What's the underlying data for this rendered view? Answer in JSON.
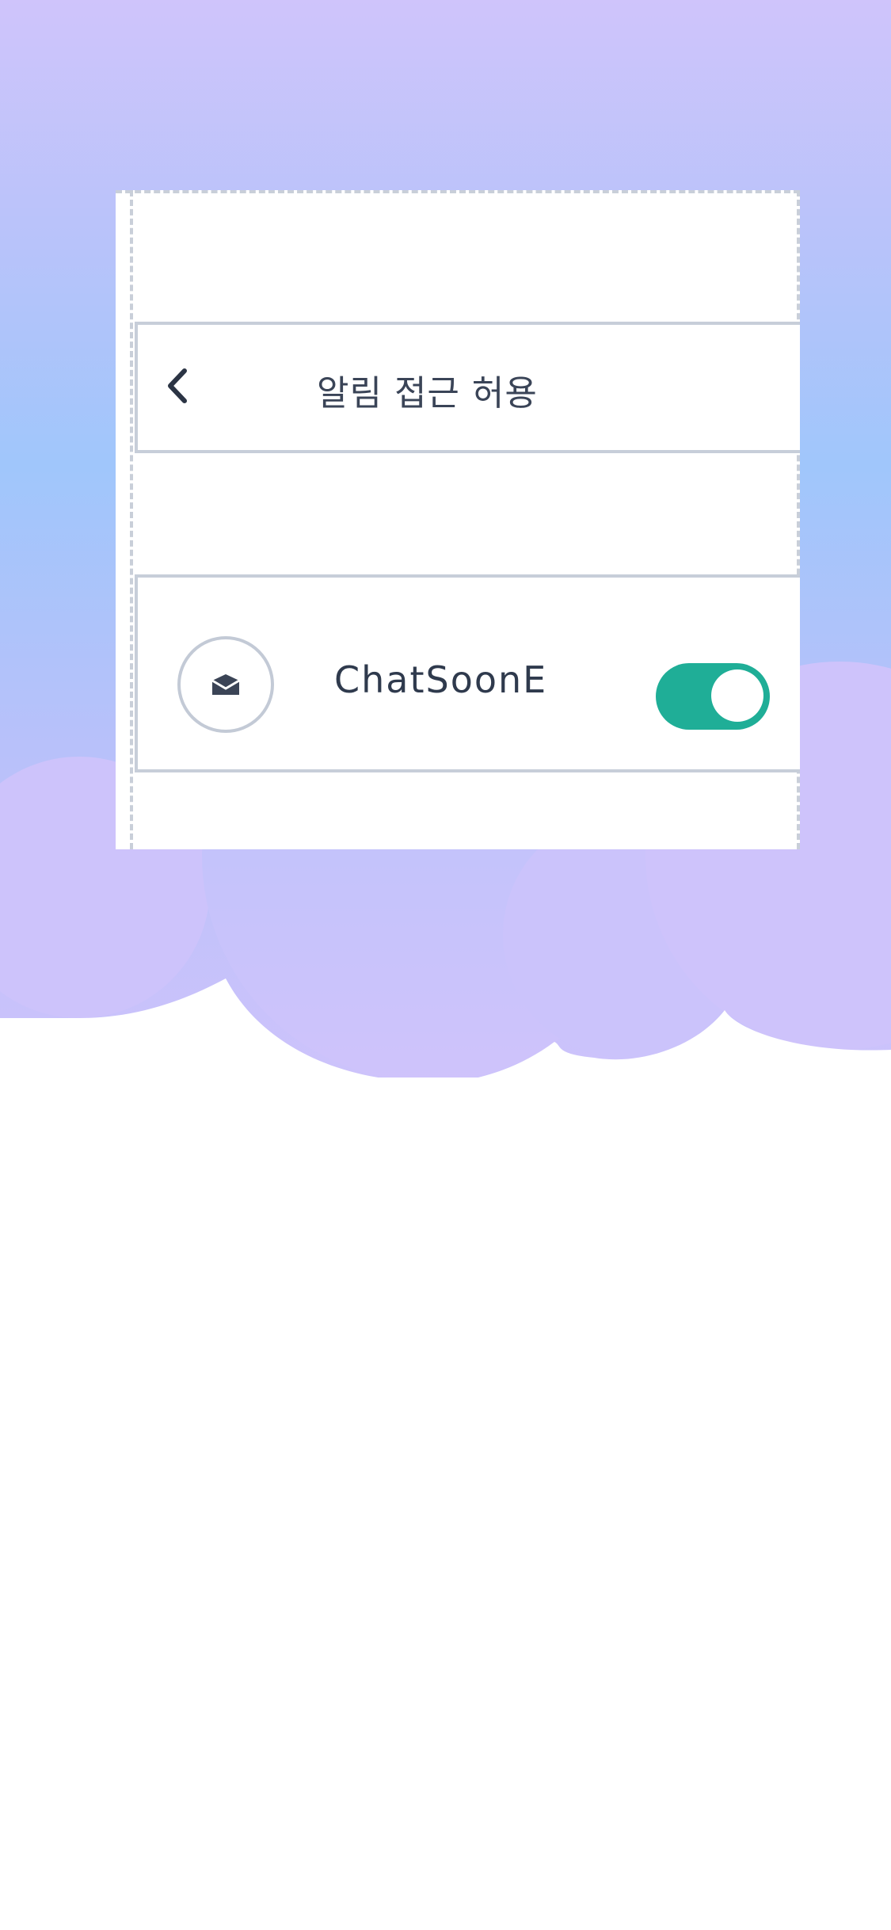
{
  "header": {
    "title": "알림 접근 허용",
    "back_icon": "chevron-left-icon"
  },
  "app_item": {
    "name": "ChatSoonE",
    "icon": "envelope-icon",
    "toggle_on": true
  },
  "colors": {
    "toggle_active": "#1fae97",
    "border": "#c7ced9",
    "text_dark": "#2f3a4d",
    "gradient_top": "#cfc4fb",
    "gradient_mid": "#a0c6fb"
  }
}
